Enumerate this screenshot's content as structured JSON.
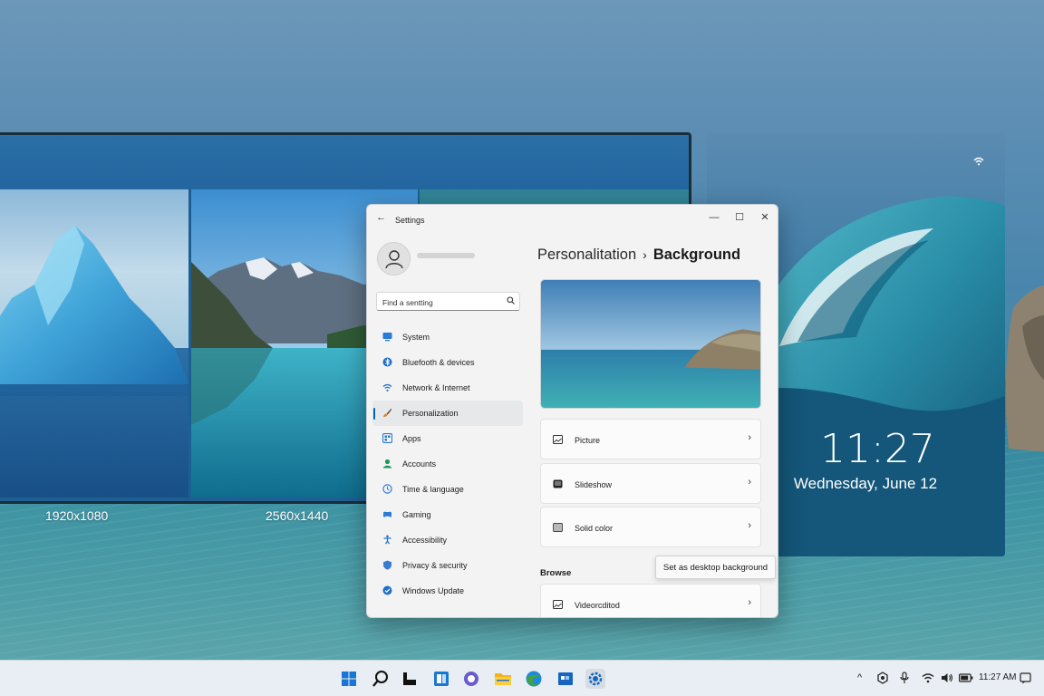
{
  "desktop": {
    "resolutions": [
      "1920x1080",
      "2560x1440"
    ]
  },
  "lock_screen": {
    "time": "11:27",
    "date": "Wednesday, June 12"
  },
  "settings": {
    "window_title": "Settings",
    "back_icon": "←",
    "minimize_icon": "—",
    "maximize_icon": "☐",
    "close_icon": "✕",
    "search": {
      "placeholder": "Find a sentting"
    },
    "nav": [
      {
        "label": "System",
        "icon": "system-icon",
        "color": "#2b7bd6"
      },
      {
        "label": "Bluefooth & devices",
        "icon": "bluetooth-icon",
        "color": "#1f6fc7"
      },
      {
        "label": "Network & Internet",
        "icon": "wifi-icon",
        "color": "#1f6fc7"
      },
      {
        "label": "Personalization",
        "icon": "brush-icon",
        "color": "#d9822b",
        "selected": true
      },
      {
        "label": "Apps",
        "icon": "apps-icon",
        "color": "#2b7bd6"
      },
      {
        "label": "Accounts",
        "icon": "accounts-icon",
        "color": "#1e9a5c"
      },
      {
        "label": "Time & language",
        "icon": "clock-icon",
        "color": "#2b7bd6"
      },
      {
        "label": "Gaming",
        "icon": "gaming-icon",
        "color": "#2b7bd6"
      },
      {
        "label": "Accessibility",
        "icon": "accessibility-icon",
        "color": "#1f6fc7"
      },
      {
        "label": "Privacy & security",
        "icon": "shield-icon",
        "color": "#3a7ccf"
      },
      {
        "label": "Windows Update",
        "icon": "update-icon",
        "color": "#1f6fc7"
      }
    ],
    "breadcrumb": {
      "parent": "Personalitation",
      "separator": "›",
      "current": "Background"
    },
    "options": [
      {
        "label": "Picture",
        "icon": "picture-icon"
      },
      {
        "label": "Slideshow",
        "icon": "slideshow-icon"
      },
      {
        "label": "Solid color",
        "icon": "solid-color-icon"
      }
    ],
    "browse": {
      "section_label": "Browse",
      "item_label": "Videorcditod",
      "tooltip": "Set as desktop background"
    },
    "chevron": "›"
  },
  "taskbar": {
    "tray_time": "11:27 AM",
    "tray_up_arrow": "^"
  },
  "colors": {
    "accent": "#0067c0",
    "window_bg": "#f3f3f3",
    "taskbar_bg": "#e8eef3"
  }
}
